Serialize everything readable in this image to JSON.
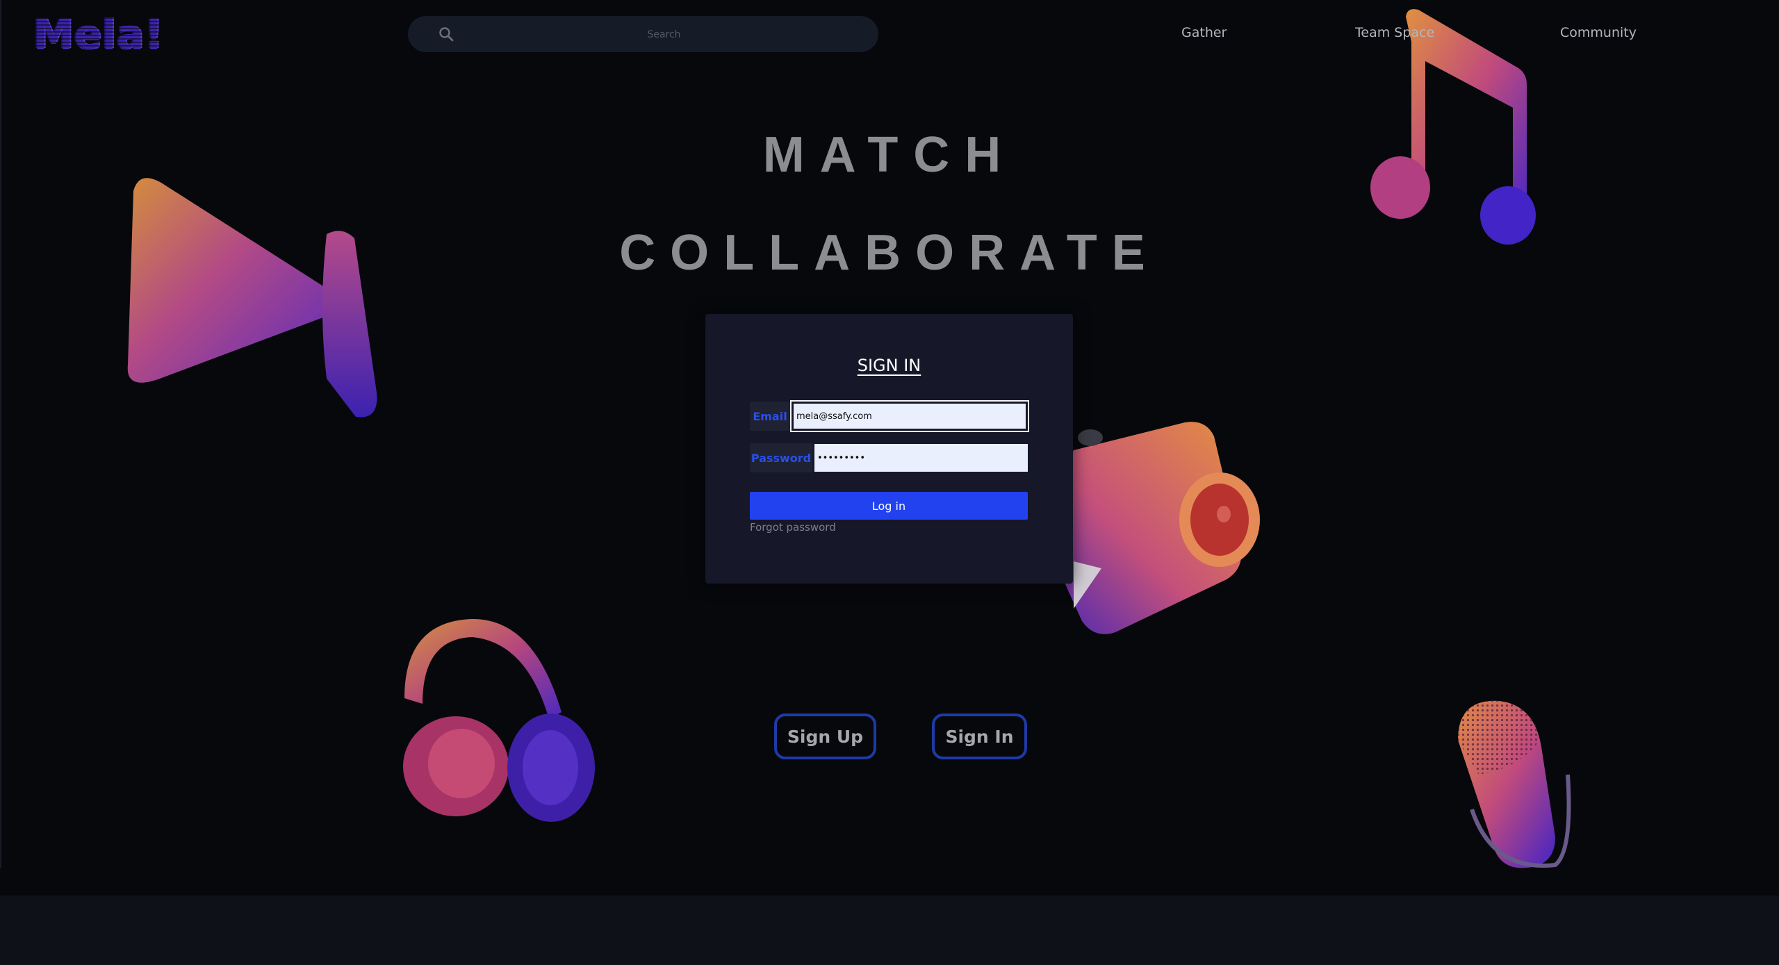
{
  "header": {
    "logo_text": "Mela!",
    "search": {
      "placeholder": "Search",
      "icon": "search-icon"
    },
    "nav": [
      {
        "label": "Gather"
      },
      {
        "label": "Team Space"
      },
      {
        "label": "Community"
      }
    ]
  },
  "hero": {
    "line1": "MATCH",
    "line2": "COLLABORATE"
  },
  "signin_panel": {
    "title": "SIGN IN",
    "email_label": "Email",
    "email_value": "mela@ssafy.com",
    "password_label": "Password",
    "password_value": "•••••••••",
    "login_button": "Log in",
    "forgot_password": "Forgot password"
  },
  "actions": {
    "sign_up": "Sign Up",
    "sign_in": "Sign In"
  },
  "decorations": [
    "play-3d-icon",
    "music-note-3d-icon",
    "camera-3d-icon",
    "headphones-3d-icon",
    "microphone-3d-icon"
  ],
  "colors": {
    "background": "#07080c",
    "accent_blue": "#2342ef",
    "panel_bg": "#161728",
    "headline_gray": "#8c8d91",
    "pill_border": "#1f3aa6"
  }
}
